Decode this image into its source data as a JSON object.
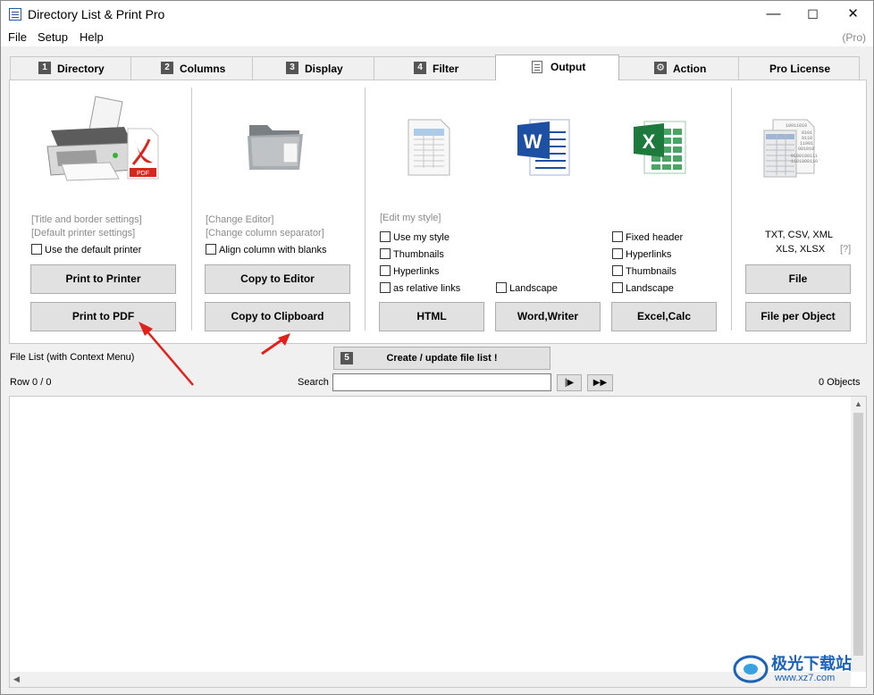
{
  "window": {
    "title": "Directory List & Print Pro",
    "minimize": "—",
    "maximize": "☐",
    "close": "✕"
  },
  "menu": {
    "items": [
      "File",
      "Setup",
      "Help"
    ],
    "edition": "(Pro)"
  },
  "tabs": [
    {
      "num": "1",
      "label": "Directory"
    },
    {
      "num": "2",
      "label": "Columns"
    },
    {
      "num": "3",
      "label": "Display"
    },
    {
      "num": "4",
      "label": "Filter"
    },
    {
      "label": "Output",
      "active": true
    },
    {
      "label": "Action"
    },
    {
      "label": "Pro License"
    }
  ],
  "print_section": {
    "link1": "[Title and border settings]",
    "link2": "[Default printer settings]",
    "checkbox": "Use the default printer",
    "btn_printer": "Print to Printer",
    "btn_pdf": "Print to PDF",
    "pdf_badge": "PDF"
  },
  "editor_section": {
    "link1": "[Change Editor]",
    "link2": "[Change column separator]",
    "checkbox": "Align column with blanks",
    "btn_editor": "Copy to Editor",
    "btn_clipboard": "Copy to Clipboard"
  },
  "html_section": {
    "link": "[Edit my style]",
    "cb1": "Use my style",
    "cb2": "Thumbnails",
    "cb3": "Hyperlinks",
    "cb4": "as relative links",
    "btn": "HTML"
  },
  "word_section": {
    "cb_landscape": "Landscape",
    "btn": "Word,Writer"
  },
  "excel_section": {
    "cb1": "Fixed header",
    "cb2": "Hyperlinks",
    "cb3": "Thumbnails",
    "cb4": "Landscape",
    "btn": "Excel,Calc"
  },
  "file_section": {
    "formats1": "TXT, CSV, XML",
    "formats2": "XLS, XLSX",
    "help": "[?]",
    "btn_file": "File",
    "btn_per_object": "File per Object",
    "binary_lines": [
      "10011010",
      "0101",
      "0110",
      "11001",
      "001010",
      "0100100111",
      "1101000110"
    ]
  },
  "list_area": {
    "title": "File List (with Context Menu)",
    "create_num": "5",
    "create_label": "Create / update file list !",
    "row_info": "Row 0 / 0",
    "search_label": "Search",
    "search_value": "",
    "nav_next": "|▶",
    "nav_fast": "▶▶",
    "objects": "0 Objects"
  },
  "watermark": {
    "text": "极光下载站",
    "url": "www.xz7.com"
  },
  "colors": {
    "accent_arrow": "#e0221b",
    "word_blue": "#1d4fa3",
    "excel_green": "#1e7a3c"
  }
}
